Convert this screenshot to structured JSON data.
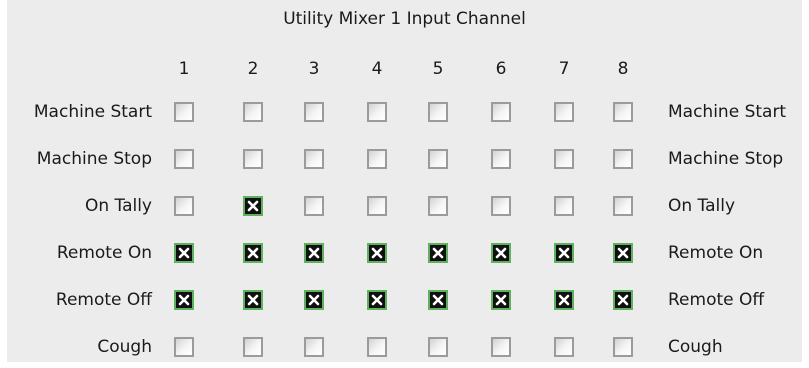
{
  "title": "Utility Mixer 1 Input Channel",
  "columns": [
    "1",
    "2",
    "3",
    "4",
    "5",
    "6",
    "7",
    "8"
  ],
  "rows": [
    {
      "label": "Machine Start",
      "checks": [
        false,
        false,
        false,
        false,
        false,
        false,
        false,
        false
      ]
    },
    {
      "label": "Machine Stop",
      "checks": [
        false,
        false,
        false,
        false,
        false,
        false,
        false,
        false
      ]
    },
    {
      "label": "On Tally",
      "checks": [
        false,
        true,
        false,
        false,
        false,
        false,
        false,
        false
      ]
    },
    {
      "label": "Remote On",
      "checks": [
        true,
        true,
        true,
        true,
        true,
        true,
        true,
        true
      ]
    },
    {
      "label": "Remote Off",
      "checks": [
        true,
        true,
        true,
        true,
        true,
        true,
        true,
        true
      ]
    },
    {
      "label": "Cough",
      "checks": [
        false,
        false,
        false,
        false,
        false,
        false,
        false,
        false
      ]
    }
  ],
  "colors": {
    "background": "#ececec",
    "checkbox_border": "#9b9b9b",
    "checked_fill": "#101010",
    "checked_border": "#5fb05f",
    "checked_mark": "#ffffff"
  },
  "icons": {
    "checked": "x-mark-icon"
  }
}
